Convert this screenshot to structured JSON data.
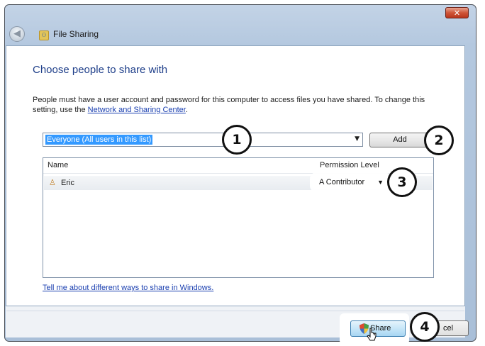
{
  "window": {
    "title": "File Sharing",
    "close_label": "✕"
  },
  "main": {
    "heading": "Choose people to share with",
    "description_before": "People must have a user account and password for this computer to access files you have shared.  To change this setting, use the ",
    "description_link": "Network and Sharing Center",
    "description_after": "."
  },
  "combo": {
    "value": "Everyone (All users in this list)"
  },
  "add_button": "Add",
  "list": {
    "columns": [
      "Name",
      "Permission Level"
    ],
    "rows": [
      {
        "name": "Eric",
        "permission": "A Contributor"
      }
    ]
  },
  "help_link": "Tell me about different ways to share in Windows.",
  "footer": {
    "share_label": "Share",
    "cancel_label": "cel"
  },
  "callouts": [
    "1",
    "2",
    "3",
    "4"
  ],
  "colors": {
    "heading": "#1f3f8a",
    "link": "#1a3fb0",
    "selection": "#3399ff",
    "callout_border": "#111111"
  }
}
